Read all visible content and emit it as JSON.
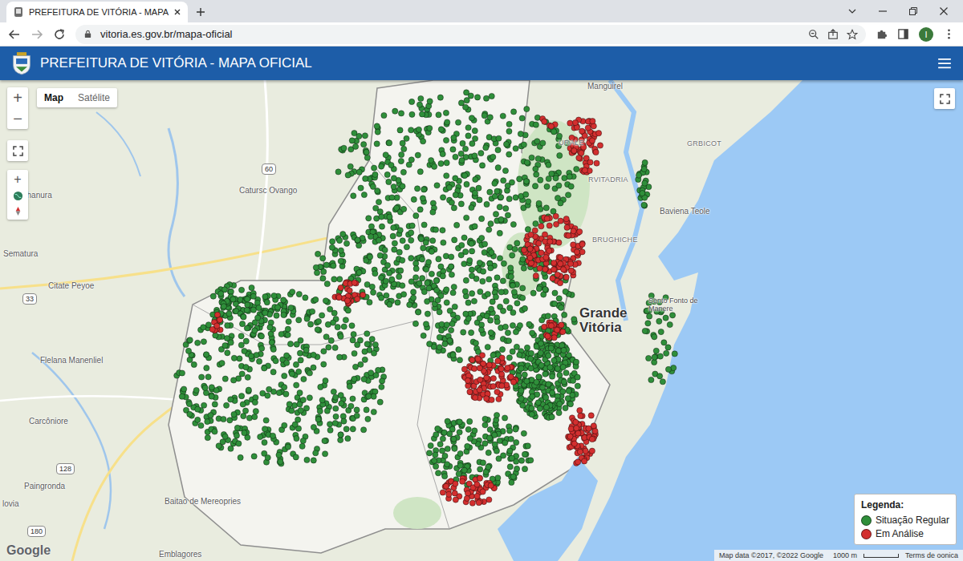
{
  "browser": {
    "tab_title": "PREFEITURA DE VITÓRIA - MAPA",
    "url": "vitoria.es.gov.br/mapa-oficial",
    "profile_initial": "I"
  },
  "header": {
    "title": "PREFEITURA DE VITÓRIA - MAPA OFICIAL"
  },
  "map_type": [
    {
      "label": "Map",
      "selected": true
    },
    {
      "label": "Satélite",
      "selected": false
    }
  ],
  "zoom": {
    "in": "+",
    "out": "−"
  },
  "side_tools": {
    "zoom_in": "+"
  },
  "labels": [
    {
      "text": "Manguirel",
      "kind": "place"
    },
    {
      "text": "URALE",
      "kind": "district"
    },
    {
      "text": "GRBICOT",
      "kind": "district"
    },
    {
      "text": "RVITADRIA",
      "kind": "district"
    },
    {
      "text": "Baviena Teole",
      "kind": "place"
    },
    {
      "text": "BRUGHICHE",
      "kind": "district"
    },
    {
      "text": "Grande Vitória",
      "kind": "major"
    },
    {
      "text": "Sento Fonto de Manere",
      "kind": "small"
    },
    {
      "text": "ahanura",
      "kind": "place"
    },
    {
      "text": "Catursc Ovango",
      "kind": "place"
    },
    {
      "text": "Sematura",
      "kind": "place"
    },
    {
      "text": "Citate Peyoe",
      "kind": "place"
    },
    {
      "text": "Flelana Manenliel",
      "kind": "place"
    },
    {
      "text": "Carcôniore",
      "kind": "place"
    },
    {
      "text": "Paingronda",
      "kind": "place"
    },
    {
      "text": "Baitao de Mereopries",
      "kind": "place"
    },
    {
      "text": "lovia",
      "kind": "place"
    },
    {
      "text": "Emblagores",
      "kind": "place"
    }
  ],
  "shields": [
    "60",
    "33",
    "128",
    "180"
  ],
  "markers": [
    {
      "color": "#2f8f3a"
    },
    {
      "color": "#2f8f3a"
    },
    {
      "color": "#2f8f3a"
    },
    {
      "color": "#2f8f3a"
    },
    {
      "color": "#2f8f3a"
    },
    {
      "color": "#2f8f3a"
    },
    {
      "color": "#2f8f3a"
    },
    {
      "color": "#2f8f3a"
    },
    {
      "color": "#2f8f3a"
    },
    {
      "color": "#d32f2f"
    },
    {
      "color": "#d32f2f"
    },
    {
      "color": "#d32f2f"
    },
    {
      "color": "#d32f2f"
    },
    {
      "color": "#d32f2f"
    },
    {
      "color": "#d32f2f"
    },
    {
      "color": "#d32f2f"
    },
    {
      "color": "#d32f2f"
    },
    {
      "color": "#d32f2f"
    }
  ],
  "legend": {
    "title": "Legenda:",
    "items": [
      {
        "label": "Situação Regular",
        "color": "#2f8f3a"
      },
      {
        "label": "Em Análise",
        "color": "#d32f2f"
      }
    ]
  },
  "attribution": {
    "google": "Google",
    "data": "Map data ©2017, ©2022 Google",
    "scale": "1000 m",
    "terms": "Terms de oonica"
  }
}
